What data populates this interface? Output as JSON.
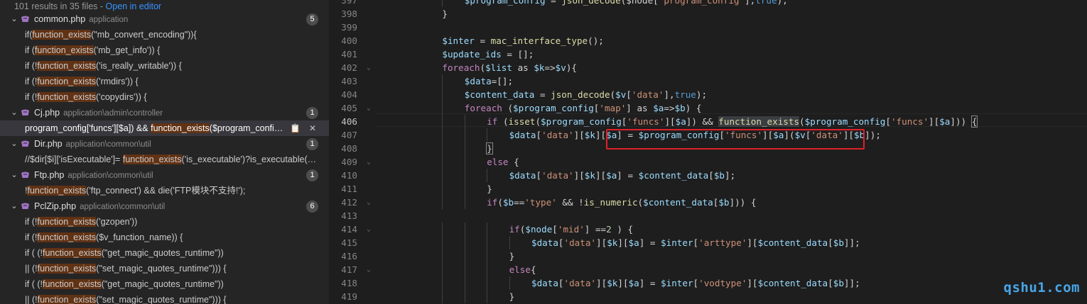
{
  "search": {
    "summary": "101 results in 35 files - ",
    "open_in_editor": "Open in editor"
  },
  "results": [
    {
      "kind": "file",
      "name": "common.php",
      "path": "application",
      "count": "5"
    },
    {
      "kind": "match",
      "parts": [
        {
          "t": "if("
        },
        {
          "t": "function_exists",
          "h": true
        },
        {
          "t": "(\"mb_convert_encoding\")){"
        }
      ]
    },
    {
      "kind": "match",
      "parts": [
        {
          "t": "if ("
        },
        {
          "t": "function_exists",
          "h": true
        },
        {
          "t": "('mb_get_info')) {"
        }
      ]
    },
    {
      "kind": "match",
      "parts": [
        {
          "t": "if (!"
        },
        {
          "t": "function_exists",
          "h": true
        },
        {
          "t": "('is_really_writable')) {"
        }
      ]
    },
    {
      "kind": "match",
      "parts": [
        {
          "t": "if (!"
        },
        {
          "t": "function_exists",
          "h": true
        },
        {
          "t": "('rmdirs')) {"
        }
      ]
    },
    {
      "kind": "match",
      "parts": [
        {
          "t": "if (!"
        },
        {
          "t": "function_exists",
          "h": true
        },
        {
          "t": "('copydirs')) {"
        }
      ]
    },
    {
      "kind": "file",
      "name": "Cj.php",
      "path": "application\\admin\\controller",
      "count": "1"
    },
    {
      "kind": "match",
      "selected": true,
      "parts": [
        {
          "t": "program_config['funcs'][$a]) && "
        },
        {
          "t": "function_exists",
          "h": true
        },
        {
          "t": "($program_config['funcs'][$a]))"
        }
      ],
      "actions": [
        "📋",
        "✕"
      ]
    },
    {
      "kind": "file",
      "name": "Dir.php",
      "path": "application\\common\\util",
      "count": "1"
    },
    {
      "kind": "match",
      "parts": [
        {
          "t": "//$dir[$i]['isExecutable']= "
        },
        {
          "t": "function_exists",
          "h": true
        },
        {
          "t": "('is_executable')?is_executable($file):false;"
        }
      ]
    },
    {
      "kind": "file",
      "name": "Ftp.php",
      "path": "application\\common\\util",
      "count": "1"
    },
    {
      "kind": "match",
      "parts": [
        {
          "t": "!"
        },
        {
          "t": "function_exists",
          "h": true
        },
        {
          "t": "('ftp_connect') && die('FTP模块不支持!');"
        }
      ]
    },
    {
      "kind": "file",
      "name": "PclZip.php",
      "path": "application\\common\\util",
      "count": "6"
    },
    {
      "kind": "match",
      "parts": [
        {
          "t": "if (!"
        },
        {
          "t": "function_exists",
          "h": true
        },
        {
          "t": "('gzopen'))"
        }
      ]
    },
    {
      "kind": "match",
      "parts": [
        {
          "t": "if (!"
        },
        {
          "t": "function_exists",
          "h": true
        },
        {
          "t": "($v_function_name)) {"
        }
      ]
    },
    {
      "kind": "match",
      "parts": [
        {
          "t": "if (   (!"
        },
        {
          "t": "function_exists",
          "h": true
        },
        {
          "t": "(\"get_magic_quotes_runtime\"))"
        }
      ]
    },
    {
      "kind": "match",
      "parts": [
        {
          "t": "|| (!"
        },
        {
          "t": "function_exists",
          "h": true
        },
        {
          "t": "(\"set_magic_quotes_runtime\"))) {"
        }
      ]
    },
    {
      "kind": "match",
      "parts": [
        {
          "t": "if (   (!"
        },
        {
          "t": "function_exists",
          "h": true
        },
        {
          "t": "(\"get_magic_quotes_runtime\"))"
        }
      ]
    },
    {
      "kind": "match",
      "parts": [
        {
          "t": "|| (!"
        },
        {
          "t": "function_exists",
          "h": true
        },
        {
          "t": "(\"set_magic_quotes_runtime\"))) {"
        }
      ]
    }
  ],
  "editor": {
    "active_line": "406",
    "lines": [
      {
        "n": "397",
        "i": 2,
        "tokens": [
          [
            "$program_config",
            "var"
          ],
          [
            " = ",
            "op"
          ],
          [
            "json_decode",
            "fn"
          ],
          [
            "($node[",
            "op"
          ],
          [
            "'program_config'",
            "str"
          ],
          [
            "],",
            "op"
          ],
          [
            "true",
            "kw"
          ],
          [
            ");",
            "op"
          ]
        ]
      },
      {
        "n": "398",
        "i": 1,
        "tokens": [
          [
            "}",
            "op"
          ]
        ]
      },
      {
        "n": "399",
        "i": 0,
        "tokens": []
      },
      {
        "n": "400",
        "i": 1,
        "tokens": [
          [
            "$inter",
            "var"
          ],
          [
            " = ",
            "op"
          ],
          [
            "mac_interface_type",
            "fn"
          ],
          [
            "();",
            "op"
          ]
        ]
      },
      {
        "n": "401",
        "i": 1,
        "tokens": [
          [
            "$update_ids",
            "var"
          ],
          [
            " = [];",
            "op"
          ]
        ]
      },
      {
        "n": "402",
        "i": 1,
        "fold": true,
        "tokens": [
          [
            "foreach",
            "ctl"
          ],
          [
            "(",
            "op"
          ],
          [
            "$list",
            "var"
          ],
          [
            " as ",
            "op"
          ],
          [
            "$k",
            "var"
          ],
          [
            "=>",
            "op"
          ],
          [
            "$v",
            "var"
          ],
          [
            "){",
            "op"
          ]
        ]
      },
      {
        "n": "403",
        "i": 2,
        "tokens": [
          [
            "$data",
            "var"
          ],
          [
            "=[];",
            "op"
          ]
        ]
      },
      {
        "n": "404",
        "i": 2,
        "tokens": [
          [
            "$content_data",
            "var"
          ],
          [
            " = ",
            "op"
          ],
          [
            "json_decode",
            "fn"
          ],
          [
            "(",
            "op"
          ],
          [
            "$v",
            "var"
          ],
          [
            "[",
            "op"
          ],
          [
            "'data'",
            "str"
          ],
          [
            "],",
            "op"
          ],
          [
            "true",
            "kw"
          ],
          [
            ");",
            "op"
          ]
        ]
      },
      {
        "n": "405",
        "i": 2,
        "fold": true,
        "tokens": [
          [
            "foreach",
            "ctl"
          ],
          [
            " (",
            "op"
          ],
          [
            "$program_config",
            "var"
          ],
          [
            "[",
            "op"
          ],
          [
            "'map'",
            "str"
          ],
          [
            "] as ",
            "op"
          ],
          [
            "$a",
            "var"
          ],
          [
            "=>",
            "op"
          ],
          [
            "$b",
            "var"
          ],
          [
            ") {",
            "op"
          ]
        ]
      },
      {
        "n": "406",
        "i": 3,
        "tokens": [
          [
            "if",
            "ctl"
          ],
          [
            " (",
            "op"
          ],
          [
            "isset",
            "fn"
          ],
          [
            "(",
            "op"
          ],
          [
            "$program_config",
            "var"
          ],
          [
            "[",
            "op"
          ],
          [
            "'funcs'",
            "str"
          ],
          [
            "][",
            "op"
          ],
          [
            "$a",
            "var"
          ],
          [
            "]) && ",
            "op"
          ],
          [
            "function_exists",
            "fnsel"
          ],
          [
            "(",
            "op"
          ],
          [
            "$program_config",
            "var"
          ],
          [
            "[",
            "op"
          ],
          [
            "'funcs'",
            "str"
          ],
          [
            "][",
            "op"
          ],
          [
            "$a",
            "var"
          ],
          [
            "])) ",
            "op"
          ],
          [
            "{",
            "brk"
          ]
        ]
      },
      {
        "n": "407",
        "i": 4,
        "tokens": [
          [
            "$data",
            "var"
          ],
          [
            "[",
            "op"
          ],
          [
            "'data'",
            "str"
          ],
          [
            "][",
            "op"
          ],
          [
            "$k",
            "var"
          ],
          [
            "][",
            "op"
          ],
          [
            "$a",
            "var"
          ],
          [
            "] = ",
            "op"
          ],
          [
            "$program_config",
            "var"
          ],
          [
            "[",
            "op"
          ],
          [
            "'funcs'",
            "str"
          ],
          [
            "][",
            "op"
          ],
          [
            "$a",
            "var"
          ],
          [
            "](",
            "op"
          ],
          [
            "$v",
            "var"
          ],
          [
            "[",
            "op"
          ],
          [
            "'data'",
            "str"
          ],
          [
            "][",
            "op"
          ],
          [
            "$b",
            "var"
          ],
          [
            "]);",
            "op"
          ]
        ]
      },
      {
        "n": "408",
        "i": 3,
        "tokens": [
          [
            "}",
            "brk"
          ]
        ]
      },
      {
        "n": "409",
        "i": 3,
        "fold": true,
        "tokens": [
          [
            "else",
            "ctl"
          ],
          [
            " {",
            "op"
          ]
        ]
      },
      {
        "n": "410",
        "i": 4,
        "tokens": [
          [
            "$data",
            "var"
          ],
          [
            "[",
            "op"
          ],
          [
            "'data'",
            "str"
          ],
          [
            "][",
            "op"
          ],
          [
            "$k",
            "var"
          ],
          [
            "][",
            "op"
          ],
          [
            "$a",
            "var"
          ],
          [
            "] = ",
            "op"
          ],
          [
            "$content_data",
            "var"
          ],
          [
            "[",
            "op"
          ],
          [
            "$b",
            "var"
          ],
          [
            "];",
            "op"
          ]
        ]
      },
      {
        "n": "411",
        "i": 3,
        "tokens": [
          [
            "}",
            "op"
          ]
        ]
      },
      {
        "n": "412",
        "i": 3,
        "fold": true,
        "tokens": [
          [
            "if",
            "ctl"
          ],
          [
            "(",
            "op"
          ],
          [
            "$b",
            "var"
          ],
          [
            "==",
            "op"
          ],
          [
            "'type'",
            "str"
          ],
          [
            " && !",
            "op"
          ],
          [
            "is_numeric",
            "fn"
          ],
          [
            "(",
            "op"
          ],
          [
            "$content_data",
            "var"
          ],
          [
            "[",
            "op"
          ],
          [
            "$b",
            "var"
          ],
          [
            "])) {",
            "op"
          ]
        ]
      },
      {
        "n": "413",
        "i": 0,
        "tokens": []
      },
      {
        "n": "414",
        "i": 4,
        "fold": true,
        "tokens": [
          [
            "if",
            "ctl"
          ],
          [
            "(",
            "op"
          ],
          [
            "$node",
            "var"
          ],
          [
            "[",
            "op"
          ],
          [
            "'mid'",
            "str"
          ],
          [
            "] ==",
            "op"
          ],
          [
            "2",
            "num"
          ],
          [
            " ) {",
            "op"
          ]
        ]
      },
      {
        "n": "415",
        "i": 5,
        "tokens": [
          [
            "$data",
            "var"
          ],
          [
            "[",
            "op"
          ],
          [
            "'data'",
            "str"
          ],
          [
            "][",
            "op"
          ],
          [
            "$k",
            "var"
          ],
          [
            "][",
            "op"
          ],
          [
            "$a",
            "var"
          ],
          [
            "] = ",
            "op"
          ],
          [
            "$inter",
            "var"
          ],
          [
            "[",
            "op"
          ],
          [
            "'arttype'",
            "str"
          ],
          [
            "][",
            "op"
          ],
          [
            "$content_data",
            "var"
          ],
          [
            "[",
            "op"
          ],
          [
            "$b",
            "var"
          ],
          [
            "]];",
            "op"
          ]
        ]
      },
      {
        "n": "416",
        "i": 4,
        "tokens": [
          [
            "}",
            "op"
          ]
        ]
      },
      {
        "n": "417",
        "i": 4,
        "fold": true,
        "tokens": [
          [
            "else",
            "ctl"
          ],
          [
            "{",
            "op"
          ]
        ]
      },
      {
        "n": "418",
        "i": 5,
        "tokens": [
          [
            "$data",
            "var"
          ],
          [
            "[",
            "op"
          ],
          [
            "'data'",
            "str"
          ],
          [
            "][",
            "op"
          ],
          [
            "$k",
            "var"
          ],
          [
            "][",
            "op"
          ],
          [
            "$a",
            "var"
          ],
          [
            "] = ",
            "op"
          ],
          [
            "$inter",
            "var"
          ],
          [
            "[",
            "op"
          ],
          [
            "'vodtype'",
            "str"
          ],
          [
            "][",
            "op"
          ],
          [
            "$content_data",
            "var"
          ],
          [
            "[",
            "op"
          ],
          [
            "$b",
            "var"
          ],
          [
            "]];",
            "op"
          ]
        ]
      },
      {
        "n": "419",
        "i": 4,
        "tokens": [
          [
            "}",
            "op"
          ]
        ]
      }
    ]
  },
  "watermark": "qshu1.com",
  "colors": {
    "accent_link": "#3794ff",
    "match_highlight": "#613214",
    "annotation_box": "#e0202a",
    "watermark": "#48a6e8"
  }
}
